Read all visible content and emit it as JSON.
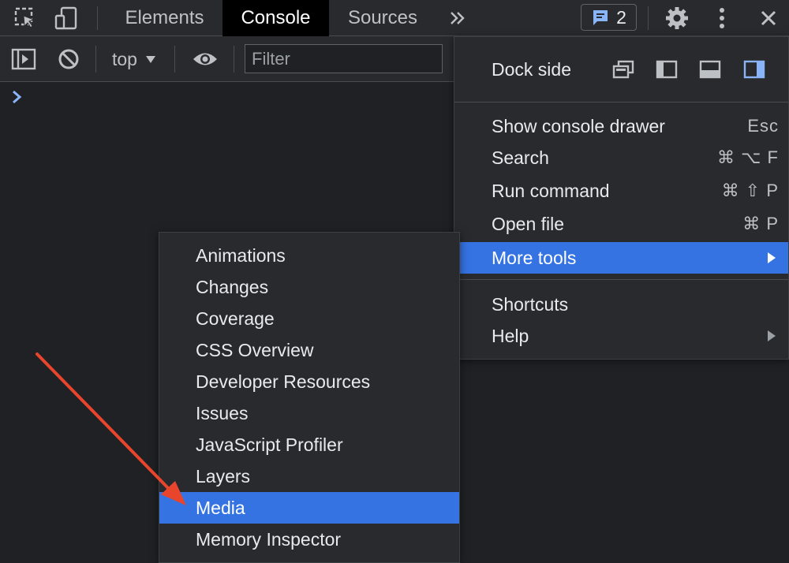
{
  "tabs": {
    "elements": "Elements",
    "console": "Console",
    "sources": "Sources",
    "issues_count": "2",
    "icons": [
      "inspect-element-icon",
      "device-toggle-icon",
      "more-tabs-icon",
      "issues-icon",
      "settings-gear-icon",
      "kebab-menu-icon",
      "close-icon"
    ]
  },
  "console_toolbar": {
    "context": "top",
    "filter_placeholder": "Filter",
    "icons": [
      "sidebar-toggle-icon",
      "clear-console-icon",
      "live-expression-eye-icon"
    ]
  },
  "main_menu": {
    "dock_side_label": "Dock side",
    "dock_options": [
      "undock",
      "dock-left",
      "dock-bottom",
      "dock-right"
    ],
    "dock_selected": "dock-right",
    "items": [
      {
        "label": "Show console drawer",
        "shortcut": "Esc"
      },
      {
        "label": "Search",
        "shortcut": "⌘ ⌥ F"
      },
      {
        "label": "Run command",
        "shortcut": "⌘ ⇧ P"
      },
      {
        "label": "Open file",
        "shortcut": "⌘ P"
      },
      {
        "label": "More tools",
        "shortcut": ""
      },
      {
        "label": "Shortcuts",
        "shortcut": ""
      },
      {
        "label": "Help",
        "shortcut": ""
      }
    ],
    "highlighted": "More tools"
  },
  "more_tools_submenu": {
    "items": [
      "Animations",
      "Changes",
      "Coverage",
      "CSS Overview",
      "Developer Resources",
      "Issues",
      "JavaScript Profiler",
      "Layers",
      "Media",
      "Memory Inspector"
    ],
    "highlighted": "Media"
  },
  "colors": {
    "background": "#202124",
    "toolbar": "#292a2d",
    "highlight": "#3573e2",
    "accent_blue": "#8ab4f8",
    "annotation_arrow": "#e8452c"
  }
}
